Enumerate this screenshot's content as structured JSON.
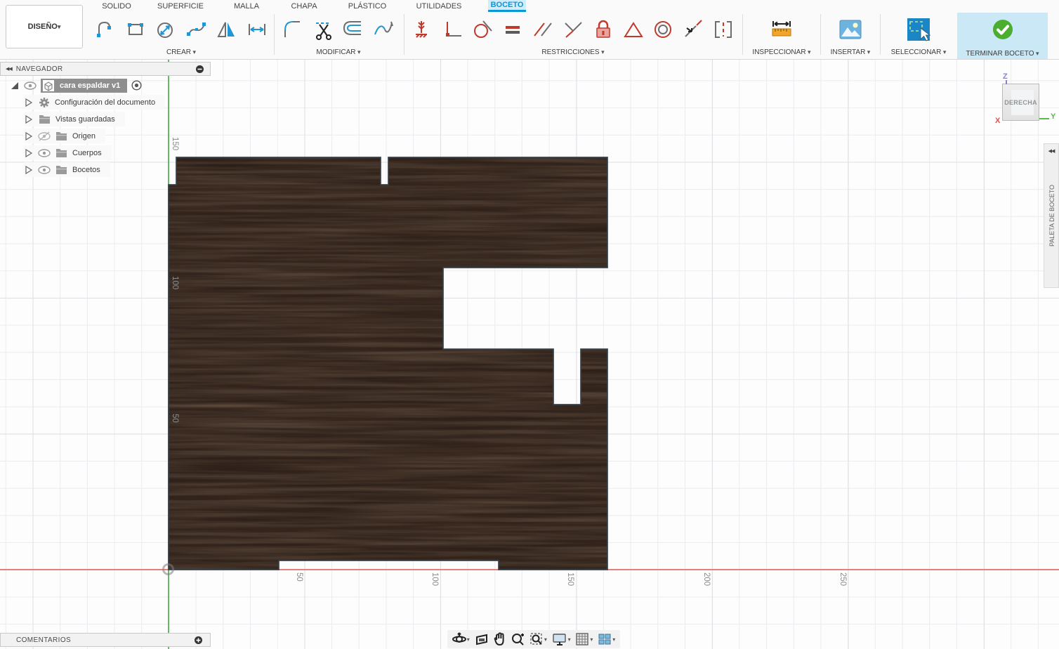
{
  "tabs": [
    "SOLIDO",
    "SUPERFICIE",
    "MALLA",
    "CHAPA",
    "PLÁSTICO",
    "UTILIDADES",
    "BOCETO"
  ],
  "design_menu": "DISEÑO",
  "groups": {
    "crear": "CREAR",
    "modificar": "MODIFICAR",
    "restricciones": "RESTRICCIONES",
    "inspeccionar": "INSPECCIONAR",
    "insertar": "INSERTAR",
    "seleccionar": "SELECCIONAR",
    "terminar": "TERMINAR BOCETO"
  },
  "navigator": {
    "title": "NAVEGADOR",
    "root_label": "cara espaldar v1",
    "items": [
      "Configuración del documento",
      "Vistas guardadas",
      "Origen",
      "Cuerpos",
      "Bocetos"
    ]
  },
  "viewcube": {
    "face": "DERECHA",
    "axis_z": "Z",
    "axis_y": "Y",
    "axis_x": "X"
  },
  "sketch_palette_label": "PALETA DE BOCETO",
  "comments_label": "COMENTARIOS",
  "axis_ticks": {
    "horizontal": [
      "50",
      "100",
      "150",
      "200",
      "250"
    ],
    "vertical": [
      "150",
      "100",
      "50"
    ]
  },
  "colors": {
    "accent_blue": "#0a97d5",
    "active_tab_bg": "#d2ecf9",
    "constraint_red": "#c0392b",
    "axis_green": "#56b256",
    "axis_red": "#e4736d",
    "wood_fill": "#483428",
    "sketch_line": "#36424a",
    "terminar_tile_bg": "#cbe8f7",
    "check_green": "#4cae30"
  }
}
